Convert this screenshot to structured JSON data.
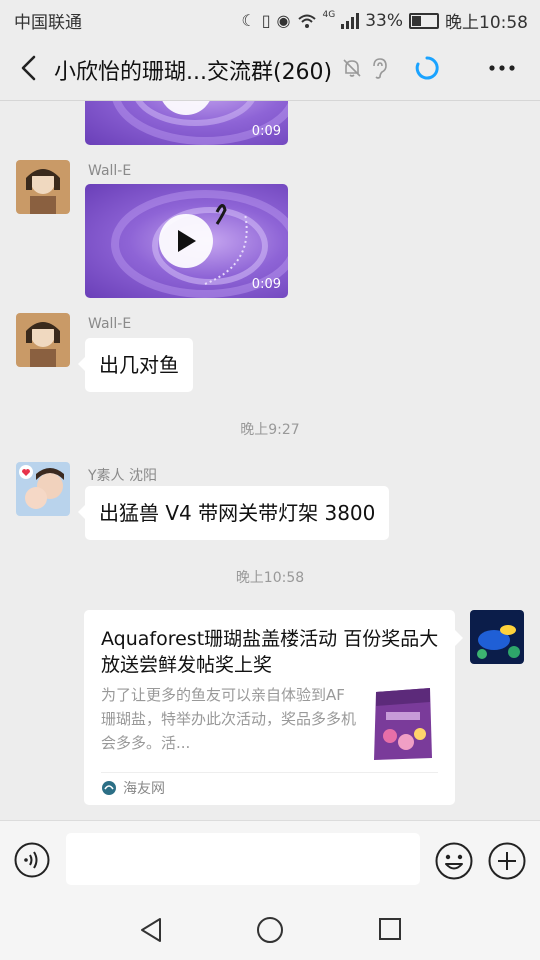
{
  "status_bar": {
    "carrier": "中国联通",
    "network": "4G",
    "battery": "33%",
    "battery_level": 0.33,
    "time": "晚上10:58"
  },
  "header": {
    "title": "小欣怡的珊瑚...交流群(260)",
    "icons": [
      "back-icon",
      "mute-icon",
      "earpiece-icon",
      "loading-icon",
      "more-icon"
    ]
  },
  "messages": {
    "video1": {
      "duration": "0:09"
    },
    "video2": {
      "sender": "Wall-E",
      "duration": "0:09"
    },
    "text1": {
      "sender": "Wall-E",
      "text": "出几对鱼"
    },
    "time1": "晚上9:27",
    "text2": {
      "sender": "Y素人 沈阳",
      "text": "出猛兽 V4 带网关带灯架 3800"
    },
    "time2": "晚上10:58",
    "card": {
      "title": "Aquaforest珊瑚盐盖楼活动 百份奖品大放送尝鲜发帖奖上奖",
      "description": "为了让更多的鱼友可以亲自体验到AF珊瑚盐，特举办此次活动，奖品多多机会多多。活...",
      "source": "海友网"
    }
  },
  "input_bar": {
    "placeholder": "",
    "icons": [
      "voice-icon",
      "emoji-icon",
      "add-icon"
    ]
  },
  "nav_bar": {
    "icons": [
      "nav-back-icon",
      "nav-home-icon",
      "nav-recent-icon"
    ]
  },
  "colors": {
    "background": "#ededed",
    "accent": "#1aa3ff",
    "video_purple": "#8e64d6"
  }
}
